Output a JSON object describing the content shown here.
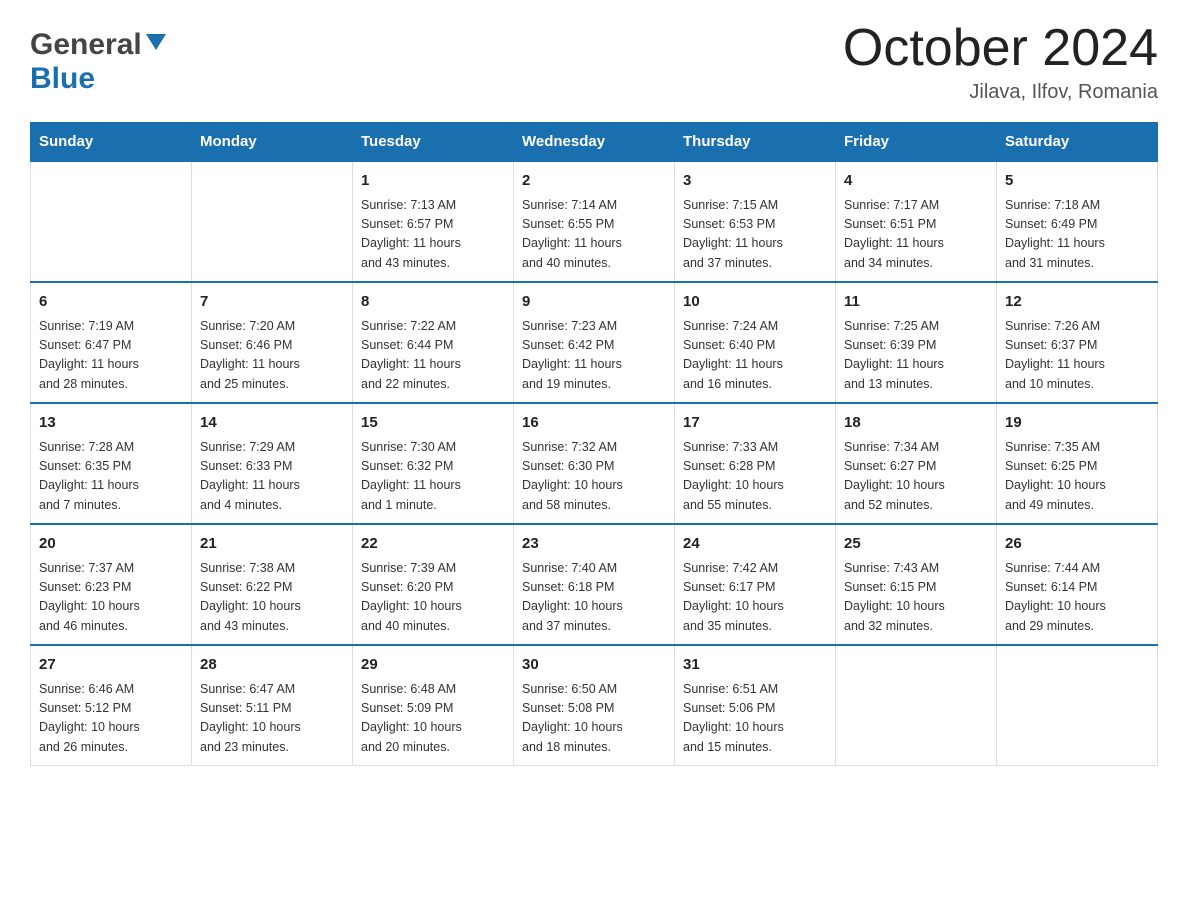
{
  "header": {
    "logo": {
      "general": "General",
      "blue": "Blue"
    },
    "title": "October 2024",
    "location": "Jilava, Ilfov, Romania"
  },
  "calendar": {
    "days_of_week": [
      "Sunday",
      "Monday",
      "Tuesday",
      "Wednesday",
      "Thursday",
      "Friday",
      "Saturday"
    ],
    "weeks": [
      [
        {
          "day": "",
          "info": ""
        },
        {
          "day": "",
          "info": ""
        },
        {
          "day": "1",
          "info": "Sunrise: 7:13 AM\nSunset: 6:57 PM\nDaylight: 11 hours\nand 43 minutes."
        },
        {
          "day": "2",
          "info": "Sunrise: 7:14 AM\nSunset: 6:55 PM\nDaylight: 11 hours\nand 40 minutes."
        },
        {
          "day": "3",
          "info": "Sunrise: 7:15 AM\nSunset: 6:53 PM\nDaylight: 11 hours\nand 37 minutes."
        },
        {
          "day": "4",
          "info": "Sunrise: 7:17 AM\nSunset: 6:51 PM\nDaylight: 11 hours\nand 34 minutes."
        },
        {
          "day": "5",
          "info": "Sunrise: 7:18 AM\nSunset: 6:49 PM\nDaylight: 11 hours\nand 31 minutes."
        }
      ],
      [
        {
          "day": "6",
          "info": "Sunrise: 7:19 AM\nSunset: 6:47 PM\nDaylight: 11 hours\nand 28 minutes."
        },
        {
          "day": "7",
          "info": "Sunrise: 7:20 AM\nSunset: 6:46 PM\nDaylight: 11 hours\nand 25 minutes."
        },
        {
          "day": "8",
          "info": "Sunrise: 7:22 AM\nSunset: 6:44 PM\nDaylight: 11 hours\nand 22 minutes."
        },
        {
          "day": "9",
          "info": "Sunrise: 7:23 AM\nSunset: 6:42 PM\nDaylight: 11 hours\nand 19 minutes."
        },
        {
          "day": "10",
          "info": "Sunrise: 7:24 AM\nSunset: 6:40 PM\nDaylight: 11 hours\nand 16 minutes."
        },
        {
          "day": "11",
          "info": "Sunrise: 7:25 AM\nSunset: 6:39 PM\nDaylight: 11 hours\nand 13 minutes."
        },
        {
          "day": "12",
          "info": "Sunrise: 7:26 AM\nSunset: 6:37 PM\nDaylight: 11 hours\nand 10 minutes."
        }
      ],
      [
        {
          "day": "13",
          "info": "Sunrise: 7:28 AM\nSunset: 6:35 PM\nDaylight: 11 hours\nand 7 minutes."
        },
        {
          "day": "14",
          "info": "Sunrise: 7:29 AM\nSunset: 6:33 PM\nDaylight: 11 hours\nand 4 minutes."
        },
        {
          "day": "15",
          "info": "Sunrise: 7:30 AM\nSunset: 6:32 PM\nDaylight: 11 hours\nand 1 minute."
        },
        {
          "day": "16",
          "info": "Sunrise: 7:32 AM\nSunset: 6:30 PM\nDaylight: 10 hours\nand 58 minutes."
        },
        {
          "day": "17",
          "info": "Sunrise: 7:33 AM\nSunset: 6:28 PM\nDaylight: 10 hours\nand 55 minutes."
        },
        {
          "day": "18",
          "info": "Sunrise: 7:34 AM\nSunset: 6:27 PM\nDaylight: 10 hours\nand 52 minutes."
        },
        {
          "day": "19",
          "info": "Sunrise: 7:35 AM\nSunset: 6:25 PM\nDaylight: 10 hours\nand 49 minutes."
        }
      ],
      [
        {
          "day": "20",
          "info": "Sunrise: 7:37 AM\nSunset: 6:23 PM\nDaylight: 10 hours\nand 46 minutes."
        },
        {
          "day": "21",
          "info": "Sunrise: 7:38 AM\nSunset: 6:22 PM\nDaylight: 10 hours\nand 43 minutes."
        },
        {
          "day": "22",
          "info": "Sunrise: 7:39 AM\nSunset: 6:20 PM\nDaylight: 10 hours\nand 40 minutes."
        },
        {
          "day": "23",
          "info": "Sunrise: 7:40 AM\nSunset: 6:18 PM\nDaylight: 10 hours\nand 37 minutes."
        },
        {
          "day": "24",
          "info": "Sunrise: 7:42 AM\nSunset: 6:17 PM\nDaylight: 10 hours\nand 35 minutes."
        },
        {
          "day": "25",
          "info": "Sunrise: 7:43 AM\nSunset: 6:15 PM\nDaylight: 10 hours\nand 32 minutes."
        },
        {
          "day": "26",
          "info": "Sunrise: 7:44 AM\nSunset: 6:14 PM\nDaylight: 10 hours\nand 29 minutes."
        }
      ],
      [
        {
          "day": "27",
          "info": "Sunrise: 6:46 AM\nSunset: 5:12 PM\nDaylight: 10 hours\nand 26 minutes."
        },
        {
          "day": "28",
          "info": "Sunrise: 6:47 AM\nSunset: 5:11 PM\nDaylight: 10 hours\nand 23 minutes."
        },
        {
          "day": "29",
          "info": "Sunrise: 6:48 AM\nSunset: 5:09 PM\nDaylight: 10 hours\nand 20 minutes."
        },
        {
          "day": "30",
          "info": "Sunrise: 6:50 AM\nSunset: 5:08 PM\nDaylight: 10 hours\nand 18 minutes."
        },
        {
          "day": "31",
          "info": "Sunrise: 6:51 AM\nSunset: 5:06 PM\nDaylight: 10 hours\nand 15 minutes."
        },
        {
          "day": "",
          "info": ""
        },
        {
          "day": "",
          "info": ""
        }
      ]
    ]
  }
}
